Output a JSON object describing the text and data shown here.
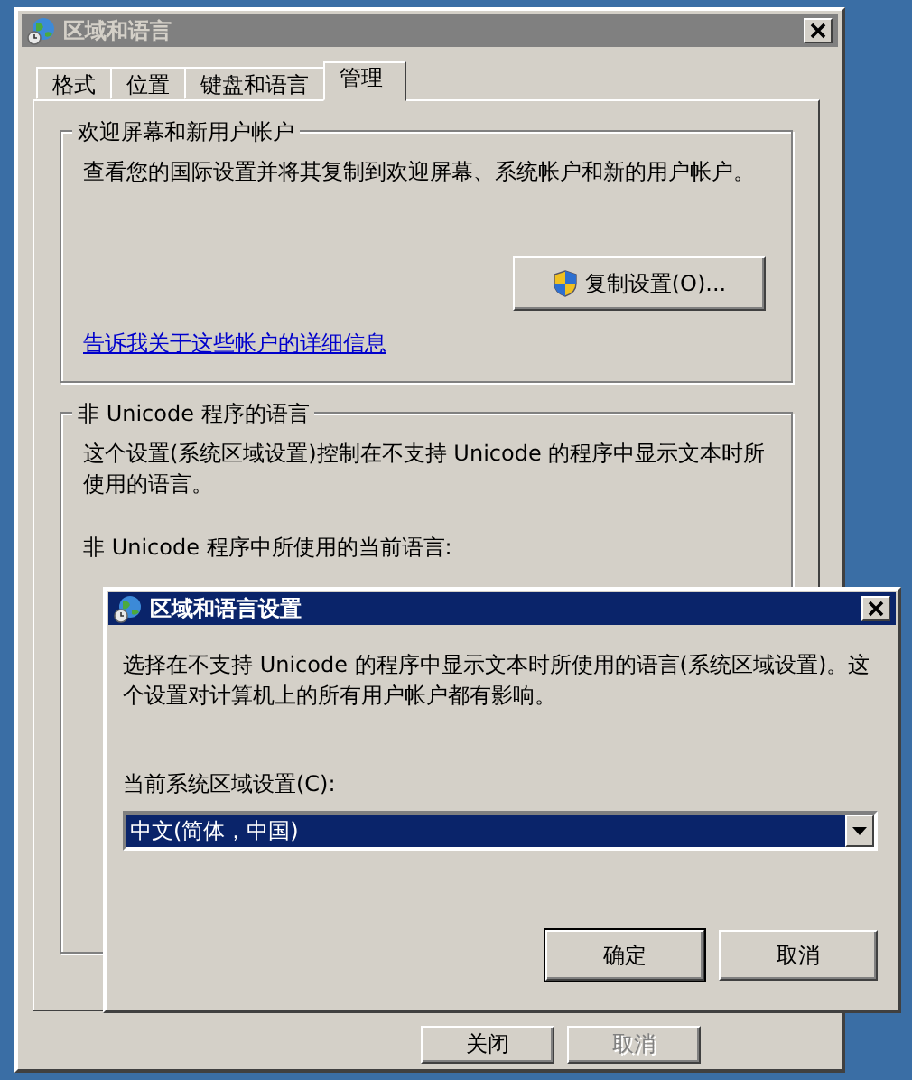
{
  "window": {
    "title": "区域和语言",
    "active": false
  },
  "tabs": [
    {
      "label": "格式",
      "selected": false
    },
    {
      "label": "位置",
      "selected": false
    },
    {
      "label": "键盘和语言",
      "selected": false
    },
    {
      "label": "管理",
      "selected": true
    }
  ],
  "welcome_group": {
    "title": "欢迎屏幕和新用户帐户",
    "description": "查看您的国际设置并将其复制到欢迎屏幕、系统帐户和新的用户帐户。",
    "copy_button": "复制设置(O)...",
    "link": "告诉我关于这些帐户的详细信息"
  },
  "unicode_group": {
    "title": "非 Unicode 程序的语言",
    "description": "这个设置(系统区域设置)控制在不支持 Unicode 的程序中显示文本时所使用的语言。",
    "current_label": "非 Unicode 程序中所使用的当前语言:"
  },
  "footer_buttons": [
    {
      "label": "关闭",
      "disabled": false
    },
    {
      "label": "取消",
      "disabled": true
    }
  ],
  "dialog": {
    "title": "区域和语言设置",
    "active": true,
    "description": "选择在不支持 Unicode 的程序中显示文本时所使用的语言(系统区域设置)。这个设置对计算机上的所有用户帐户都有影响。",
    "field_label": "当前系统区域设置(C):",
    "value": "中文(简体，中国)",
    "buttons": [
      {
        "label": "确定",
        "default": true
      },
      {
        "label": "取消",
        "default": false
      }
    ]
  }
}
